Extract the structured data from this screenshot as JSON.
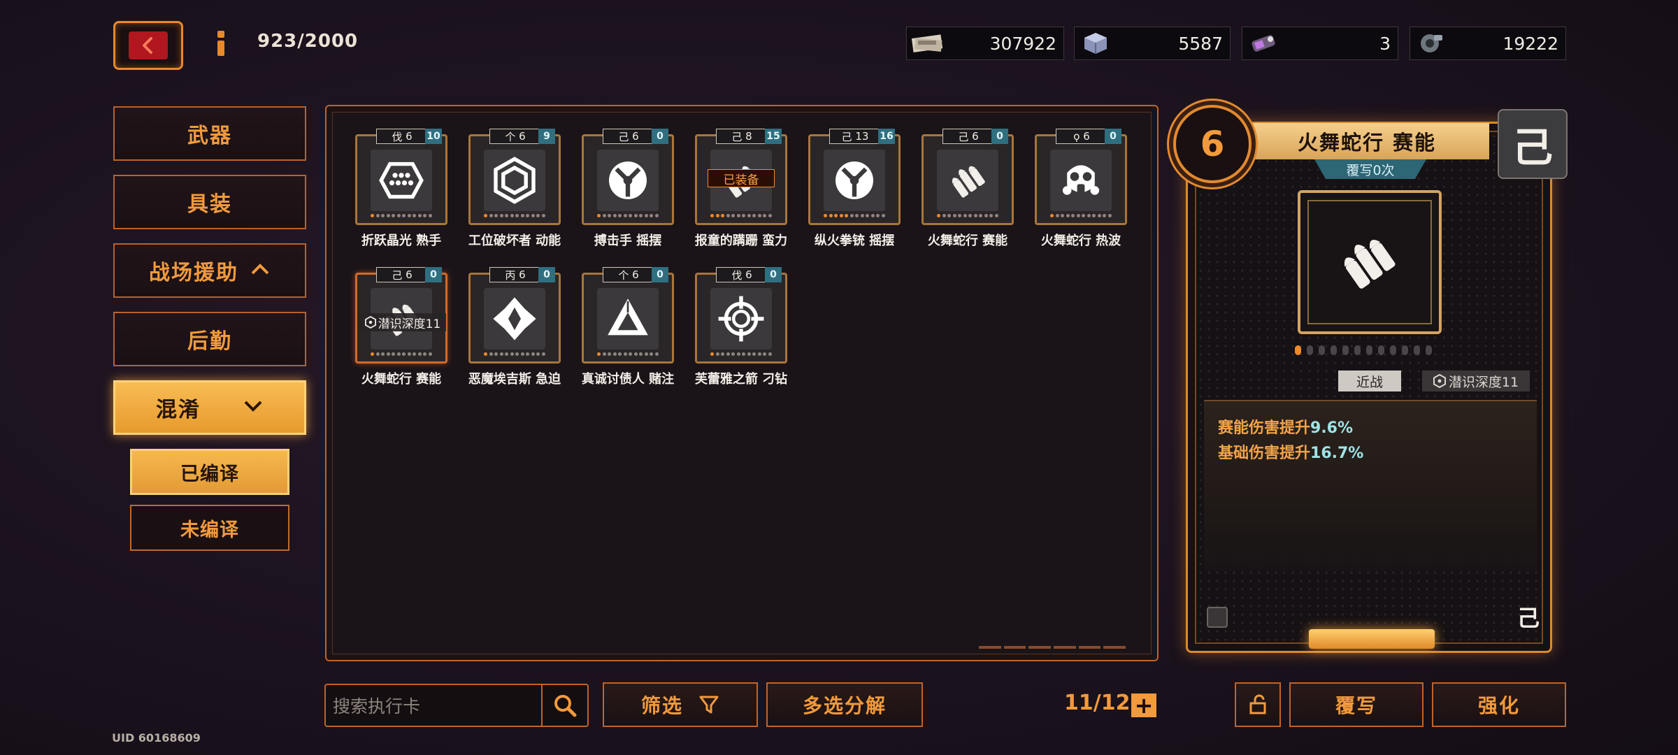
{
  "header": {
    "capacity": "923/2000",
    "currencies": [
      {
        "icon": "cash-bundle-icon",
        "value": "307922"
      },
      {
        "icon": "material-crate-icon",
        "value": "5587"
      },
      {
        "icon": "data-chip-icon",
        "value": "3"
      },
      {
        "icon": "gear-part-icon",
        "value": "19222"
      }
    ]
  },
  "sidebar": {
    "items": [
      {
        "label": "武器"
      },
      {
        "label": "具装"
      },
      {
        "label": "战场援助"
      },
      {
        "label": "后勤"
      },
      {
        "label": "混淆"
      }
    ],
    "sub_items": [
      {
        "label": "已编译"
      },
      {
        "label": "未编译"
      }
    ]
  },
  "cards": [
    {
      "glyph": "伐",
      "level": "6",
      "count": "10",
      "name": "折跃晶光 熟手",
      "icon": "hexagon-dots-icon",
      "orange_dots": 1
    },
    {
      "glyph": "个",
      "level": "6",
      "count": "9",
      "name": "工位破坏者 动能",
      "icon": "hex-ring-icon",
      "orange_dots": 1
    },
    {
      "glyph": "己",
      "level": "6",
      "count": "0",
      "name": "搏击手 摇摆",
      "icon": "tri-claw-icon",
      "orange_dots": 1
    },
    {
      "glyph": "己",
      "level": "8",
      "count": "15",
      "name": "报童的蹒跚 蛮力",
      "icon": "shell-icon",
      "orange_dots": 3,
      "equipped": "已装备"
    },
    {
      "glyph": "己",
      "level": "13",
      "count": "16",
      "name": "纵火拳铳 摇摆",
      "icon": "tri-claw-icon",
      "orange_dots": 5
    },
    {
      "glyph": "己",
      "level": "6",
      "count": "0",
      "name": "火舞蛇行 赛能",
      "icon": "shell-icon",
      "orange_dots": 1
    },
    {
      "glyph": "ϙ",
      "level": "6",
      "count": "0",
      "name": "火舞蛇行 热波",
      "icon": "gas-mask-icon",
      "orange_dots": 1
    },
    {
      "glyph": "己",
      "level": "6",
      "count": "0",
      "name": "火舞蛇行 赛能",
      "icon": "shell-icon",
      "orange_dots": 1,
      "locked": "潜识深度11",
      "selected": true
    },
    {
      "glyph": "丙",
      "level": "6",
      "count": "0",
      "name": "恶魔埃吉斯 急迫",
      "icon": "star-diamond-icon",
      "orange_dots": 1
    },
    {
      "glyph": "个",
      "level": "6",
      "count": "0",
      "name": "真诚讨债人 赌注",
      "icon": "triangle-blade-icon",
      "orange_dots": 1
    },
    {
      "glyph": "伐",
      "level": "6",
      "count": "0",
      "name": "芙蕾雅之箭 刁钻",
      "icon": "crosshair-icon",
      "orange_dots": 1
    }
  ],
  "bottom": {
    "search_placeholder": "搜索执行卡",
    "filter_label": "筛选",
    "multi_label": "多选分解",
    "pager": "11/12",
    "overwrite_label": "覆写",
    "enhance_label": "强化",
    "uid": "UID 60168609"
  },
  "detail": {
    "level": "6",
    "title": "火舞蛇行 赛能",
    "overwrite_count": "覆写0次",
    "glyph": "己",
    "tag_type": "近战",
    "tag_depth": "潜识深度11",
    "stats": [
      {
        "label": "赛能伤害提升",
        "value": "9.6%"
      },
      {
        "label": "基础伤害提升",
        "value": "16.7%"
      }
    ],
    "pips_total": 12,
    "pips_on": 1
  },
  "colors": {
    "accent": "#f29a3c",
    "panel_border": "#c0642a",
    "count_badge": "#2f6f80",
    "stat_value": "#9fe3e6"
  }
}
